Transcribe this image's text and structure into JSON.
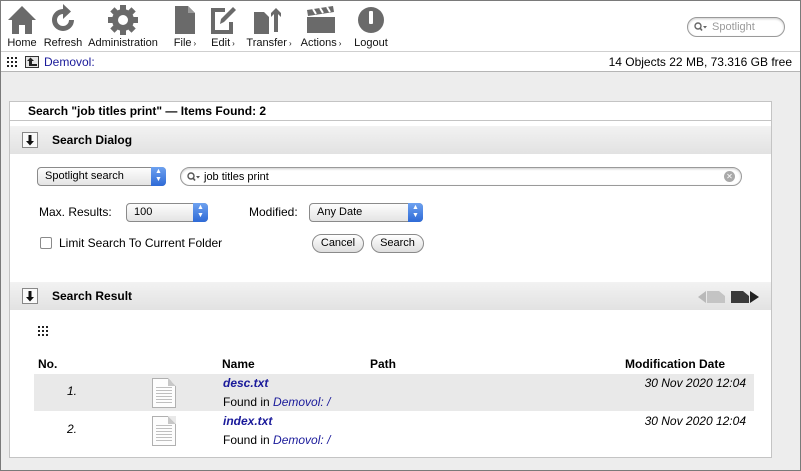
{
  "toolbar": {
    "home": "Home",
    "refresh": "Refresh",
    "administration": "Administration",
    "file": "File",
    "edit": "Edit",
    "transfer": "Transfer",
    "actions": "Actions",
    "logout": "Logout",
    "menu_arrow": "›",
    "spotlight_placeholder": "Spotlight"
  },
  "pathbar": {
    "volume": "Demovol:",
    "info": "14 Objects 22 MB, 73.316 GB free"
  },
  "panel": {
    "title": "Search \"job titles print\" — Items Found: 2"
  },
  "search_dialog": {
    "title": "Search Dialog",
    "search_type": "Spotlight search",
    "query": "job titles print",
    "max_results_label": "Max. Results:",
    "max_results_value": "100",
    "modified_label": "Modified:",
    "modified_value": "Any Date",
    "limit_label": "Limit Search To Current Folder",
    "limit_checked": false,
    "cancel": "Cancel",
    "search": "Search"
  },
  "search_result": {
    "title": "Search Result",
    "columns": {
      "no": "No.",
      "name": "Name",
      "path": "Path",
      "date": "Modification Date"
    },
    "found_in_label": "Found in",
    "rows": [
      {
        "no": "1.",
        "name": "desc.txt",
        "folder": "Demovol: /",
        "date": "30 Nov 2020 12:04"
      },
      {
        "no": "2.",
        "name": "index.txt",
        "folder": "Demovol: /",
        "date": "30 Nov 2020 12:04"
      }
    ]
  }
}
